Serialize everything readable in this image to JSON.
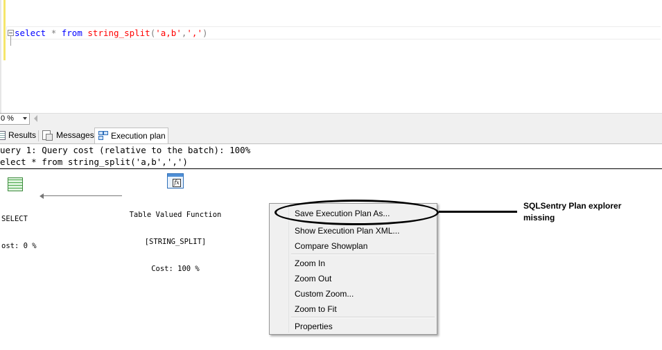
{
  "editor": {
    "code_tokens": [
      "select",
      "*",
      "from",
      "string_split",
      "(",
      "'a,b'",
      ",",
      "','",
      ")"
    ]
  },
  "toolbar": {
    "zoom_value": "0 %"
  },
  "result_tabs": [
    {
      "label": "Results",
      "icon": "grid-icon"
    },
    {
      "label": "Messages",
      "icon": "messages-icon"
    },
    {
      "label": "Execution plan",
      "icon": "execution-plan-icon",
      "active": true
    }
  ],
  "plan": {
    "query_header": "uery 1: Query cost (relative to the batch): 100%",
    "query_text": "elect * from string_split('a,b',',')",
    "select_node": {
      "name": "SELECT",
      "cost": "ost: 0 %"
    },
    "tvf_node": {
      "line1": "Table Valued Function",
      "line2": "[STRING_SPLIT]",
      "cost": "Cost: 100 %"
    }
  },
  "context_menu": {
    "items": [
      "Save Execution Plan As...",
      "Show Execution Plan XML...",
      "Compare Showplan",
      "Zoom In",
      "Zoom Out",
      "Custom Zoom...",
      "Zoom to Fit",
      "Properties"
    ]
  },
  "annotation": {
    "text": "SQLSentry Plan explorer missing"
  }
}
